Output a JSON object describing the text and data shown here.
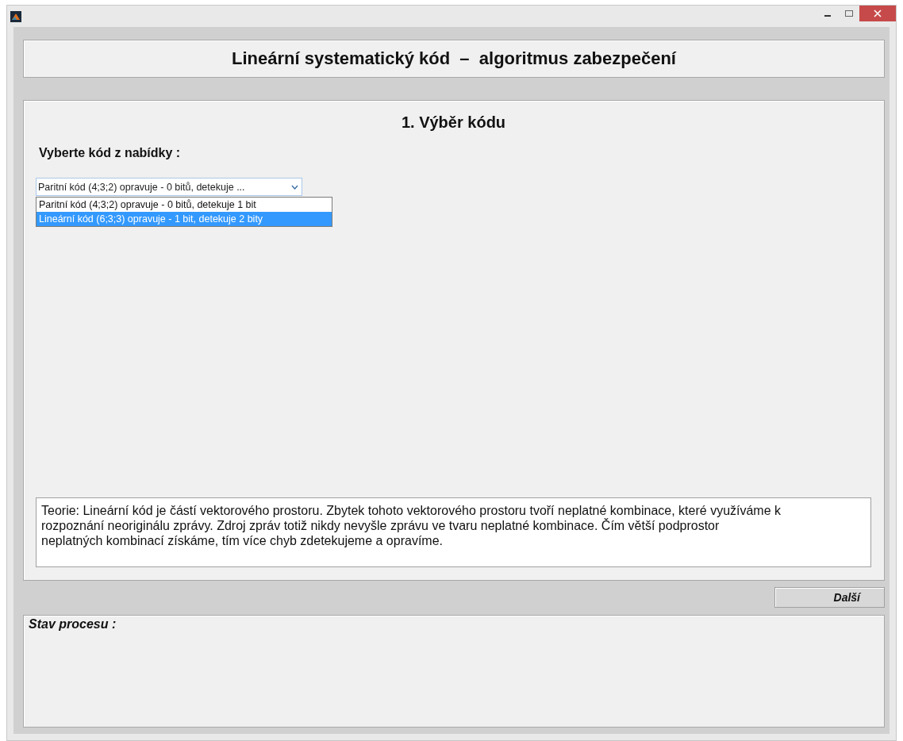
{
  "header": {
    "title": "Lineární systematický kód  –  algoritmus zabezpečení"
  },
  "step": {
    "title": "1. Výběr kódu",
    "prompt": "Vyberte kód z nabídky :",
    "dropdown": {
      "value": "Paritní kód (4;3;2) opravuje - 0 bitů, detekuje ...",
      "expanded": true,
      "options": [
        {
          "label": "Paritní kód (4;3;2) opravuje - 0 bitů, detekuje 1 bit",
          "selected": false
        },
        {
          "label": "Lineární kód (6;3;3) opravuje - 1 bit, detekuje 2 bity",
          "selected": true
        }
      ]
    },
    "theory": "Teorie: Lineární kód je částí vektorového prostoru. Zbytek tohoto vektorového prostoru tvoří neplatné kombinace, které využíváme k rozpoznání neoriginálu zprávy. Zdroj zpráv totiž nikdy nevyšle zprávu ve tvaru neplatné kombinace. Čím větší podprostor neplatných kombinací získáme, tím více chyb zdetekujeme a opravíme."
  },
  "next_button": "Další",
  "status": {
    "title": "Stav procesu :"
  }
}
